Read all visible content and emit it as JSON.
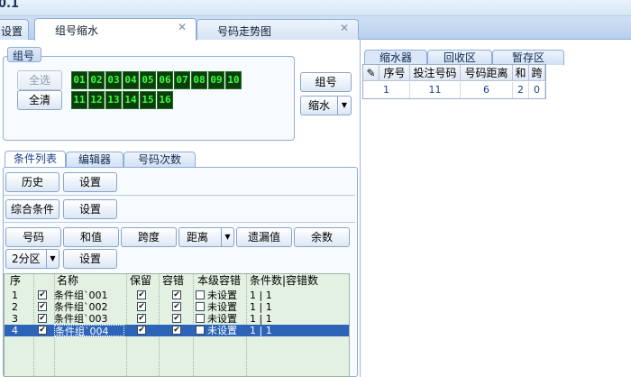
{
  "app": {
    "title_fragment": "0.1"
  },
  "main_tabs": [
    {
      "label": "设置",
      "active": false
    },
    {
      "label": "组号缩水",
      "active": true
    },
    {
      "label": "号码走势图",
      "active": false
    }
  ],
  "group_section": {
    "legend": "组号",
    "select_all": "全选",
    "clear_all": "全清",
    "numbers_row1": [
      "01",
      "02",
      "03",
      "04",
      "05",
      "06",
      "07",
      "08",
      "09",
      "10"
    ],
    "numbers_row2": [
      "11",
      "12",
      "13",
      "14",
      "15",
      "16"
    ],
    "group_button": "组号",
    "shrink_button": "缩水"
  },
  "sub_tabs": [
    {
      "label": "条件列表",
      "active": true
    },
    {
      "label": "编辑器",
      "active": false
    },
    {
      "label": "号码次数",
      "active": false
    }
  ],
  "conditions": {
    "history": "历史",
    "settings": "设置",
    "composite": "综合条件",
    "composite_settings": "设置",
    "row3": [
      "号码",
      "和值",
      "跨度",
      "距离",
      "遗漏值",
      "余数"
    ],
    "zone_select": "2分区",
    "zone_settings": "设置"
  },
  "grid": {
    "headers": [
      "序",
      "名称",
      "保留",
      "容错",
      "本级容错",
      "条件数|容错数"
    ],
    "rows": [
      {
        "seq": "1",
        "name": "条件组`001",
        "set": "未设置",
        "counts": "1 | 1",
        "selected": false
      },
      {
        "seq": "2",
        "name": "条件组`002",
        "set": "未设置",
        "counts": "1 | 1",
        "selected": false
      },
      {
        "seq": "3",
        "name": "条件组`003",
        "set": "未设置",
        "counts": "1 | 1",
        "selected": false
      },
      {
        "seq": "4",
        "name": "条件组`004",
        "set": "未设置",
        "counts": "1 | 1",
        "selected": true
      }
    ]
  },
  "right_tabs": [
    {
      "label": "缩水器",
      "active": true
    },
    {
      "label": "回收区",
      "active": false
    },
    {
      "label": "暂存区",
      "active": false
    }
  ],
  "right_table": {
    "headers": [
      "序号",
      "投注号码",
      "号码距离",
      "和",
      "跨"
    ],
    "row": [
      "1",
      "11",
      "6",
      "2",
      "0"
    ]
  },
  "colors": {
    "selection": "#2d64b8",
    "lcd_bg": "#0c3d0c",
    "lcd_fg": "#3cff3c",
    "grid_bg": "#e2f1e2"
  }
}
